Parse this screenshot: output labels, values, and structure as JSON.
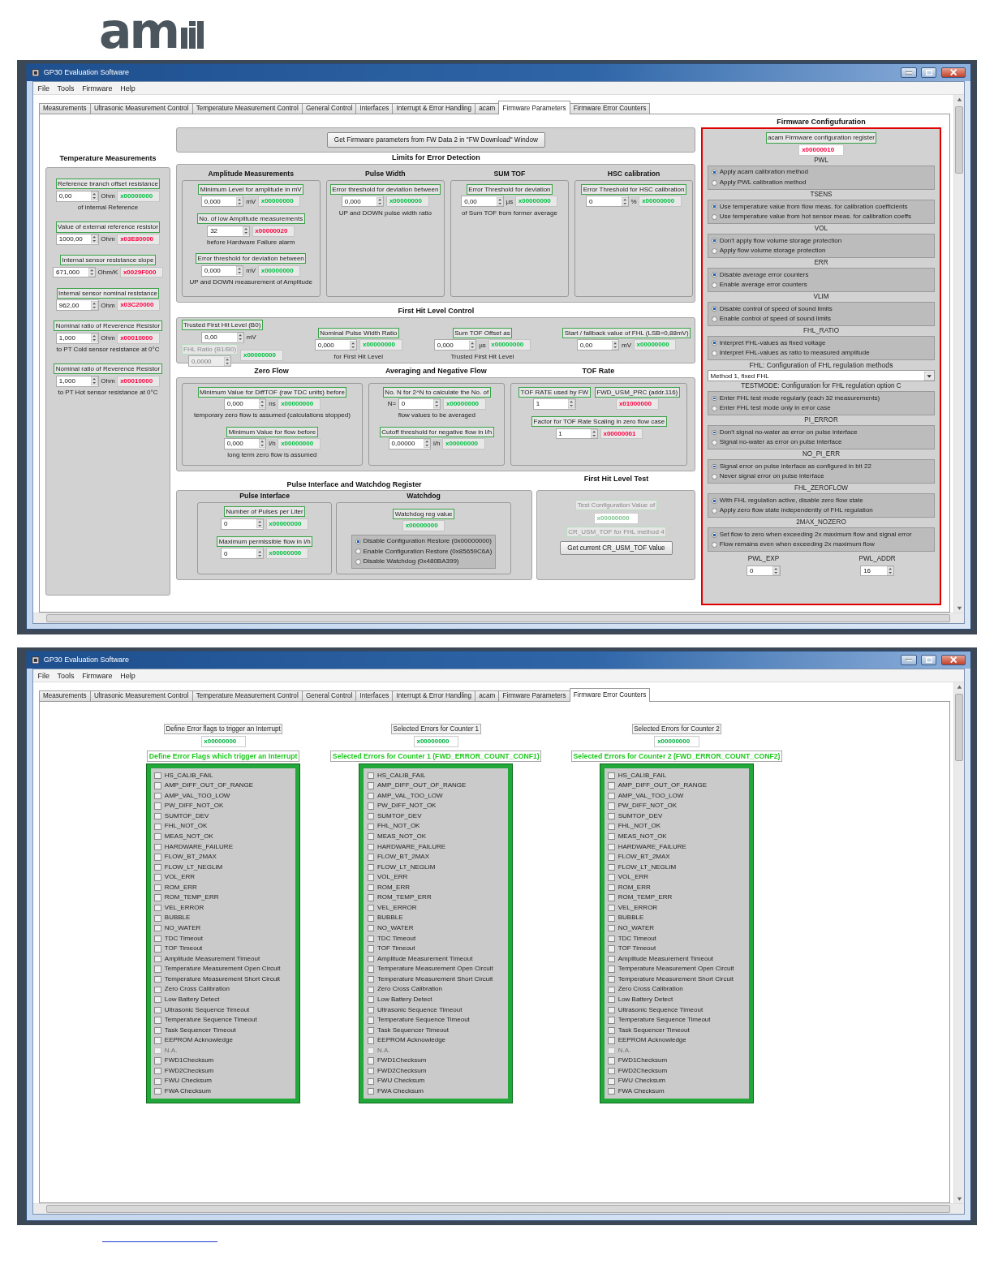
{
  "logo": {
    "text": "am"
  },
  "windows": [
    {
      "title": "GP30 Evaluation Software",
      "menu": [
        "File",
        "Tools",
        "Firmware",
        "Help"
      ],
      "tabs": [
        {
          "label": "Measurements",
          "selected": false
        },
        {
          "label": "Ultrasonic Measurement Control",
          "selected": false
        },
        {
          "label": "Temperature Measurement Control",
          "selected": false
        },
        {
          "label": "General Control",
          "selected": false
        },
        {
          "label": "Interfaces",
          "selected": false
        },
        {
          "label": "Interrupt & Error Handling",
          "selected": false
        },
        {
          "label": "acam",
          "selected": false
        },
        {
          "label": "Firmware Parameters",
          "selected": true
        },
        {
          "label": "Firmware Error Counters",
          "selected": false
        }
      ],
      "page": {
        "kind": "parameters",
        "get_button": "Get Firmware parameters from FW Data 2 in \"FW Download\" Window",
        "temperature": {
          "title": "Temperature Measurements",
          "fields": [
            {
              "label": "Reference branch offset resistance",
              "value": "0,00",
              "unit": "Ohm",
              "hex": "x00000000",
              "color": "#00c040",
              "note": "of internal Reference"
            },
            {
              "label": "Value of external reference resistor",
              "value": "1000,00",
              "unit": "Ohm",
              "hex": "x03E80000",
              "color": "#ff0040"
            },
            {
              "label": "Internal sensor resistance slope",
              "value": "671,000",
              "unit": "Ohm/K",
              "hex": "x0029F000",
              "color": "#ff0040"
            },
            {
              "label": "Internal sensor nominal resistance",
              "value": "962,00",
              "unit": "Ohm",
              "hex": "x03C20000",
              "color": "#ff0040"
            },
            {
              "label": "Nominal ratio of Reverence Resistor",
              "value": "1,000",
              "unit": "Ohm",
              "hex": "x00010000",
              "color": "#ff0040",
              "note": "to PT Cold sensor resistance at 0°C"
            },
            {
              "label": "Nominal ratio of Reverence Resistor",
              "value": "1,000",
              "unit": "Ohm",
              "hex": "x00010000",
              "color": "#ff0040",
              "note": "to PT Hot sensor resistance at 0°C"
            }
          ]
        },
        "limits": {
          "title": "Limits for Error Detection",
          "groups": [
            {
              "title": "Amplitude Measurements",
              "fields": [
                {
                  "label": "Minimum Level for amplitude in mV",
                  "value": "0,000",
                  "unit": "mV",
                  "hex": "x00000000",
                  "color": "#00c040"
                },
                {
                  "label": "No. of low Amplitude measurements",
                  "value": "32",
                  "hex": "x00000020",
                  "color": "#ff0040",
                  "note": "before Hardware Failure alarm"
                },
                {
                  "label": "Error threshold for deviation between",
                  "value": "0,000",
                  "unit": "mV",
                  "hex": "x00000000",
                  "color": "#00c040",
                  "note": "UP and DOWN measurement of Amplitude"
                }
              ]
            },
            {
              "title": "Pulse Width",
              "fields": [
                {
                  "label": "Error threshold for deviation between",
                  "value": "0,000",
                  "hex": "x00000000",
                  "color": "#00c040",
                  "note": "UP and DOWN pulse width ratio"
                }
              ]
            },
            {
              "title": "SUM TOF",
              "fields": [
                {
                  "label": "Error Threshold for deviation",
                  "value": "0,00",
                  "unit": "µs",
                  "hex": "x00000000",
                  "color": "#00c040",
                  "note": "of Sum TOF from former average"
                }
              ]
            },
            {
              "title": "HSC calibration",
              "fields": [
                {
                  "label": "Error Threshold for HSC calibration",
                  "value": "0",
                  "unit": "%",
                  "hex": "x00000000",
                  "color": "#00c040"
                }
              ]
            }
          ]
        },
        "fhl": {
          "title": "First Hit Level Control",
          "trusted": {
            "label": "Trusted First Hit Level (B0)",
            "value": "0,00",
            "unit": "mV",
            "hex": "x00000000",
            "color": "#00c040"
          },
          "ratio": {
            "label": "FHL Ratio (B1/B0)",
            "value": "0,0000",
            "disabled": true
          },
          "fields": [
            {
              "label": "Nominal Pulse Width Ratio",
              "value": "0,000",
              "hex": "x00000000",
              "color": "#00c040",
              "note": "for First Hit Level"
            },
            {
              "label": "Sum TOF Offset as",
              "value": "0,000",
              "unit": "µs",
              "hex": "x00000000",
              "color": "#00c040",
              "note": "Trusted First Hit Level"
            },
            {
              "label": "Start / fallback value of FHL (LSB=0,88mV)",
              "value": "0,00",
              "unit": "mV",
              "hex": "x00000000",
              "color": "#00c040"
            }
          ]
        },
        "flow": [
          {
            "title": "Zero Flow",
            "fields": [
              {
                "label": "Minimum Value for DiffTOF (raw TDC units) before",
                "value": "0,000",
                "unit": "ns",
                "hex": "x00000000",
                "color": "#00c040",
                "note": "temporary zero flow is assumed (calculations stopped)"
              },
              {
                "label": "Minimum Value for flow before",
                "value": "0,000",
                "unit": "l/h",
                "hex": "x00000000",
                "color": "#00c040",
                "note": "long term zero flow is assumed"
              }
            ]
          },
          {
            "title": "Averaging and Negative Flow",
            "fields": [
              {
                "label": "No. N for 2^N to calculate the No. of",
                "prefix": "N=",
                "value": "0",
                "hex": "x00000000",
                "color": "#00c040",
                "note": "flow values to be averaged"
              },
              {
                "label": "Cutoff threshold for negative flow in l/h",
                "value": "0,00000",
                "unit": "l/h",
                "hex": "x00000000",
                "color": "#00c040"
              }
            ]
          },
          {
            "title": "TOF Rate",
            "fields": [
              {
                "label": "TOF RATE used by FW",
                "value": "1"
              },
              {
                "label": "FWD_USM_PRC (addr.116)",
                "hex": "x01000000",
                "color": "#ff0040"
              },
              {
                "label": "Factor for TOF Rate Scaling in zero flow case",
                "value": "1",
                "hex": "x00000001",
                "color": "#ff0040"
              }
            ]
          }
        ],
        "pulse": {
          "title": "Pulse Interface and Watchdog Register",
          "interface": {
            "title": "Pulse Interface",
            "fields": [
              {
                "label": "Number of Pulses per Liter",
                "value": "0",
                "hex": "x00000000",
                "color": "#00c040"
              },
              {
                "label": "Maximum permissible flow in l/h",
                "value": "0",
                "hex": "x00000000",
                "color": "#00c040"
              }
            ]
          },
          "watchdog": {
            "title": "Watchdog",
            "field": {
              "label": "Watchdog reg value",
              "hex": "x00000000",
              "color": "#00c040"
            },
            "options": [
              {
                "label": "Disable Configuration Restore (0x00000000)",
                "selected": true
              },
              {
                "label": "Enable Configuration Restore (0x85659C6A)",
                "selected": false
              },
              {
                "label": "Disable Watchdog (0x480BA399)",
                "selected": false
              }
            ]
          }
        },
        "fhl_test": {
          "title": "First Hit Level Test",
          "label": "Test Configuration Value of",
          "hex": "x00000000",
          "note": "CR_USM_TOF for FHL method 4",
          "disabled": true,
          "button": "Get current CR_USM_TOF Value"
        },
        "config": {
          "title": "Firmware Configufuration",
          "register": {
            "label": "acam Firmware configuration register",
            "hex": "x00000010",
            "color": "#ff0040"
          },
          "items": [
            {
              "kind": "radio",
              "title": "PWL",
              "options": [
                {
                  "label": "Apply acam calibration method",
                  "selected": true
                },
                {
                  "label": "Apply PWL calibration method",
                  "selected": false
                }
              ]
            },
            {
              "kind": "radio",
              "title": "TSENS",
              "options": [
                {
                  "label": "Use temperature value from flow meas. for calibration coefficients",
                  "selected": true
                },
                {
                  "label": "Use temperature value from hot sensor meas. for calibration coeffs",
                  "selected": false
                }
              ]
            },
            {
              "kind": "radio",
              "title": "VOL",
              "options": [
                {
                  "label": "Don't apply flow volume storage protection",
                  "selected": true
                },
                {
                  "label": "Apply flow volume storage protection",
                  "selected": false
                }
              ]
            },
            {
              "kind": "radio",
              "title": "ERR",
              "options": [
                {
                  "label": "Disable average error counters",
                  "selected": true
                },
                {
                  "label": "Enable average error counters",
                  "selected": false
                }
              ]
            },
            {
              "kind": "radio",
              "title": "VLIM",
              "options": [
                {
                  "label": "Disable control of speed of sound limits",
                  "selected": true
                },
                {
                  "label": "Enable control of speed of sound limits",
                  "selected": false
                }
              ]
            },
            {
              "kind": "radio",
              "title": "FHL_RATIO",
              "options": [
                {
                  "label": "Interpret FHL-values as fixed voltage",
                  "selected": true
                },
                {
                  "label": "Interpret FHL-values as ratio to measured amplitude",
                  "selected": false
                }
              ]
            },
            {
              "kind": "select",
              "title": "FHL: Configuration of FHL regulation methods",
              "value": "Method 1, fixed FHL"
            },
            {
              "kind": "radio",
              "title": "TESTMODE: Configuration for FHL regulation option C",
              "options": [
                {
                  "label": "Enter FHL test mode regularly (each 32 measurements)",
                  "selected": true
                },
                {
                  "label": "Enter FHL test mode only in error case",
                  "selected": false
                }
              ]
            },
            {
              "kind": "radio",
              "title": "PI_ERROR",
              "options": [
                {
                  "label": "Don't signal no-water as error on pulse interface",
                  "selected": true
                },
                {
                  "label": "Signal no-water as error on pulse interface",
                  "selected": false
                }
              ]
            },
            {
              "kind": "radio",
              "title": "NO_PI_ERR",
              "options": [
                {
                  "label": "Signal error on pulse interface as configured in bit 22",
                  "selected": true
                },
                {
                  "label": "Never signal error on pulse interface",
                  "selected": false
                }
              ]
            },
            {
              "kind": "radio",
              "title": "FHL_ZEROFLOW",
              "options": [
                {
                  "label": "With FHL regulation active, disable zero flow state",
                  "selected": true
                },
                {
                  "label": "Apply zero flow state independently of FHL regulation",
                  "selected": false
                }
              ]
            },
            {
              "kind": "radio",
              "title": "2MAX_NOZERO",
              "options": [
                {
                  "label": "Set flow to zero when exceeding 2x maximum flow and signal error",
                  "selected": true
                },
                {
                  "label": "Flow remains even when exceeding 2x maximum flow",
                  "selected": false
                }
              ]
            },
            {
              "kind": "numbers",
              "fields": [
                {
                  "label": "PWL_EXP",
                  "value": "0"
                },
                {
                  "label": "PWL_ADDR",
                  "value": "16"
                }
              ]
            }
          ]
        }
      }
    },
    {
      "title": "GP30 Evaluation Software",
      "menu": [
        "File",
        "Tools",
        "Firmware",
        "Help"
      ],
      "tabs": [
        {
          "label": "Measurements",
          "selected": false
        },
        {
          "label": "Ultrasonic Measurement Control",
          "selected": false
        },
        {
          "label": "Temperature Measurement Control",
          "selected": false
        },
        {
          "label": "General Control",
          "selected": false
        },
        {
          "label": "Interfaces",
          "selected": false
        },
        {
          "label": "Interrupt & Error Handling",
          "selected": false
        },
        {
          "label": "acam",
          "selected": false
        },
        {
          "label": "Firmware Parameters",
          "selected": false
        },
        {
          "label": "Firmware Error Counters",
          "selected": true
        }
      ],
      "page": {
        "kind": "counters",
        "columns": [
          {
            "header": "Define Error flags to trigger an Interrupt",
            "hex": "x00000000",
            "title": "Define Error Flags which trigger an Interrupt",
            "flags": [
              {
                "label": "HS_CALIB_FAIL",
                "checked": false,
                "disabled": false
              },
              {
                "label": "AMP_DIFF_OUT_OF_RANGE",
                "checked": false,
                "disabled": false
              },
              {
                "label": "AMP_VAL_TOO_LOW",
                "checked": false,
                "disabled": false
              },
              {
                "label": "PW_DIFF_NOT_OK",
                "checked": false,
                "disabled": false
              },
              {
                "label": "SUMTOF_DEV",
                "checked": false,
                "disabled": false
              },
              {
                "label": "FHL_NOT_OK",
                "checked": false,
                "disabled": false
              },
              {
                "label": "MEAS_NOT_OK",
                "checked": false,
                "disabled": false
              },
              {
                "label": "HARDWARE_FAILURE",
                "checked": false,
                "disabled": false
              },
              {
                "label": "FLOW_BT_2MAX",
                "checked": false,
                "disabled": false
              },
              {
                "label": "FLOW_LT_NEGLIM",
                "checked": false,
                "disabled": false
              },
              {
                "label": "VOL_ERR",
                "checked": false,
                "disabled": false
              },
              {
                "label": "ROM_ERR",
                "checked": false,
                "disabled": false
              },
              {
                "label": "ROM_TEMP_ERR",
                "checked": false,
                "disabled": false
              },
              {
                "label": "VEL_ERROR",
                "checked": false,
                "disabled": false
              },
              {
                "label": "BUBBLE",
                "checked": false,
                "disabled": false
              },
              {
                "label": "NO_WATER",
                "checked": false,
                "disabled": false
              },
              {
                "label": "TDC Timeout",
                "checked": false,
                "disabled": false
              },
              {
                "label": "TOF Timeout",
                "checked": false,
                "disabled": false
              },
              {
                "label": "Amplitude Measurement Timeout",
                "checked": false,
                "disabled": false
              },
              {
                "label": "Temperature Measurement Open Circuit",
                "checked": false,
                "disabled": false
              },
              {
                "label": "Temperature Measurement Short Circuit",
                "checked": false,
                "disabled": false
              },
              {
                "label": "Zero Cross Calibration",
                "checked": false,
                "disabled": false
              },
              {
                "label": "Low Battery Detect",
                "checked": false,
                "disabled": false
              },
              {
                "label": "Ultrasonic Sequence Timeout",
                "checked": false,
                "disabled": false
              },
              {
                "label": "Temperature Sequence Timeout",
                "checked": false,
                "disabled": false
              },
              {
                "label": "Task Sequencer Timeout",
                "checked": false,
                "disabled": false
              },
              {
                "label": "EEPROM Acknowledge",
                "checked": false,
                "disabled": false
              },
              {
                "label": "N.A.",
                "checked": false,
                "disabled": true
              },
              {
                "label": "FWD1Checksum",
                "checked": false,
                "disabled": false
              },
              {
                "label": "FWD2Checksum",
                "checked": false,
                "disabled": false
              },
              {
                "label": "FWU Checksum",
                "checked": false,
                "disabled": false
              },
              {
                "label": "FWA Checksum",
                "checked": false,
                "disabled": false
              }
            ]
          },
          {
            "header": "Selected Errors for Counter 1",
            "hex": "x00000000",
            "title": "Selected Errors for Counter 1 (FWD_ERROR_COUNT_CONF1)",
            "flags": [
              {
                "label": "HS_CALIB_FAIL",
                "checked": false,
                "disabled": false
              },
              {
                "label": "AMP_DIFF_OUT_OF_RANGE",
                "checked": false,
                "disabled": false
              },
              {
                "label": "AMP_VAL_TOO_LOW",
                "checked": false,
                "disabled": false
              },
              {
                "label": "PW_DIFF_NOT_OK",
                "checked": false,
                "disabled": false
              },
              {
                "label": "SUMTOF_DEV",
                "checked": false,
                "disabled": false
              },
              {
                "label": "FHL_NOT_OK",
                "checked": false,
                "disabled": false
              },
              {
                "label": "MEAS_NOT_OK",
                "checked": false,
                "disabled": false
              },
              {
                "label": "HARDWARE_FAILURE",
                "checked": false,
                "disabled": false
              },
              {
                "label": "FLOW_BT_2MAX",
                "checked": false,
                "disabled": false
              },
              {
                "label": "FLOW_LT_NEGLIM",
                "checked": false,
                "disabled": false
              },
              {
                "label": "VOL_ERR",
                "checked": false,
                "disabled": false
              },
              {
                "label": "ROM_ERR",
                "checked": false,
                "disabled": false
              },
              {
                "label": "ROM_TEMP_ERR",
                "checked": false,
                "disabled": false
              },
              {
                "label": "VEL_ERROR",
                "checked": false,
                "disabled": false
              },
              {
                "label": "BUBBLE",
                "checked": false,
                "disabled": false
              },
              {
                "label": "NO_WATER",
                "checked": false,
                "disabled": false
              },
              {
                "label": "TDC Timeout",
                "checked": false,
                "disabled": false
              },
              {
                "label": "TOF Timeout",
                "checked": false,
                "disabled": false
              },
              {
                "label": "Amplitude Measurement Timeout",
                "checked": false,
                "disabled": false
              },
              {
                "label": "Temperature Measurement Open Circuit",
                "checked": false,
                "disabled": false
              },
              {
                "label": "Temperature Measurement Short Circuit",
                "checked": false,
                "disabled": false
              },
              {
                "label": "Zero Cross Calibration",
                "checked": false,
                "disabled": false
              },
              {
                "label": "Low Battery Detect",
                "checked": false,
                "disabled": false
              },
              {
                "label": "Ultrasonic Sequence Timeout",
                "checked": false,
                "disabled": false
              },
              {
                "label": "Temperature Sequence Timeout",
                "checked": false,
                "disabled": false
              },
              {
                "label": "Task Sequencer Timeout",
                "checked": false,
                "disabled": false
              },
              {
                "label": "EEPROM Acknowledge",
                "checked": false,
                "disabled": false
              },
              {
                "label": "N.A.",
                "checked": false,
                "disabled": true
              },
              {
                "label": "FWD1Checksum",
                "checked": false,
                "disabled": false
              },
              {
                "label": "FWD2Checksum",
                "checked": false,
                "disabled": false
              },
              {
                "label": "FWU Checksum",
                "checked": false,
                "disabled": false
              },
              {
                "label": "FWA Checksum",
                "checked": false,
                "disabled": false
              }
            ]
          },
          {
            "header": "Selected Errors for Counter 2",
            "hex": "x00000000",
            "title": "Selected Errors for Counter 2 (FWD_ERROR_COUNT_CONF2)",
            "flags": [
              {
                "label": "HS_CALIB_FAIL",
                "checked": false,
                "disabled": false
              },
              {
                "label": "AMP_DIFF_OUT_OF_RANGE",
                "checked": false,
                "disabled": false
              },
              {
                "label": "AMP_VAL_TOO_LOW",
                "checked": false,
                "disabled": false
              },
              {
                "label": "PW_DIFF_NOT_OK",
                "checked": false,
                "disabled": false
              },
              {
                "label": "SUMTOF_DEV",
                "checked": false,
                "disabled": false
              },
              {
                "label": "FHL_NOT_OK",
                "checked": false,
                "disabled": false
              },
              {
                "label": "MEAS_NOT_OK",
                "checked": false,
                "disabled": false
              },
              {
                "label": "HARDWARE_FAILURE",
                "checked": false,
                "disabled": false
              },
              {
                "label": "FLOW_BT_2MAX",
                "checked": false,
                "disabled": false
              },
              {
                "label": "FLOW_LT_NEGLIM",
                "checked": false,
                "disabled": false
              },
              {
                "label": "VOL_ERR",
                "checked": false,
                "disabled": false
              },
              {
                "label": "ROM_ERR",
                "checked": false,
                "disabled": false
              },
              {
                "label": "ROM_TEMP_ERR",
                "checked": false,
                "disabled": false
              },
              {
                "label": "VEL_ERROR",
                "checked": false,
                "disabled": false
              },
              {
                "label": "BUBBLE",
                "checked": false,
                "disabled": false
              },
              {
                "label": "NO_WATER",
                "checked": false,
                "disabled": false
              },
              {
                "label": "TDC Timeout",
                "checked": false,
                "disabled": false
              },
              {
                "label": "TOF Timeout",
                "checked": false,
                "disabled": false
              },
              {
                "label": "Amplitude Measurement Timeout",
                "checked": false,
                "disabled": false
              },
              {
                "label": "Temperature Measurement Open Circuit",
                "checked": false,
                "disabled": false
              },
              {
                "label": "Temperature Measurement Short Circuit",
                "checked": false,
                "disabled": false
              },
              {
                "label": "Zero Cross Calibration",
                "checked": false,
                "disabled": false
              },
              {
                "label": "Low Battery Detect",
                "checked": false,
                "disabled": false
              },
              {
                "label": "Ultrasonic Sequence Timeout",
                "checked": false,
                "disabled": false
              },
              {
                "label": "Temperature Sequence Timeout",
                "checked": false,
                "disabled": false
              },
              {
                "label": "Task Sequencer Timeout",
                "checked": false,
                "disabled": false
              },
              {
                "label": "EEPROM Acknowledge",
                "checked": false,
                "disabled": false
              },
              {
                "label": "N.A.",
                "checked": false,
                "disabled": true
              },
              {
                "label": "FWD1Checksum",
                "checked": false,
                "disabled": false
              },
              {
                "label": "FWD2Checksum",
                "checked": false,
                "disabled": false
              },
              {
                "label": "FWU Checksum",
                "checked": false,
                "disabled": false
              },
              {
                "label": "FWA Checksum",
                "checked": false,
                "disabled": false
              }
            ]
          }
        ]
      }
    }
  ]
}
